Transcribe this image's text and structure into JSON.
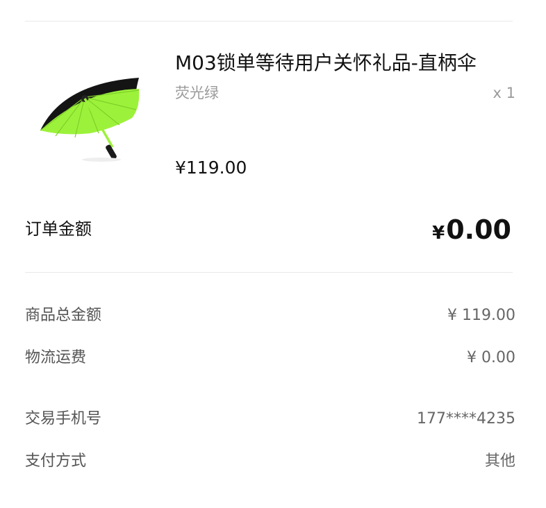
{
  "product": {
    "name": "M03锁单等待用户关怀礼品-直柄伞",
    "variant": "荧光绿",
    "quantity": "x 1",
    "price": "¥119.00",
    "image_alt": "green umbrella"
  },
  "order_total": {
    "label": "订单金额",
    "currency": "¥",
    "amount": "0.00"
  },
  "details": {
    "goods_total": {
      "label": "商品总金额",
      "value": "¥ 119.00"
    },
    "shipping": {
      "label": "物流运费",
      "value": "¥ 0.00"
    },
    "phone": {
      "label": "交易手机号",
      "value": "177****4235"
    },
    "payment": {
      "label": "支付方式",
      "value": "其他"
    }
  },
  "colors": {
    "umbrella_canopy_outer": "#141414",
    "umbrella_canopy_inner": "#9cf23a",
    "text_primary": "#111111",
    "text_secondary": "#9a9a9a"
  }
}
